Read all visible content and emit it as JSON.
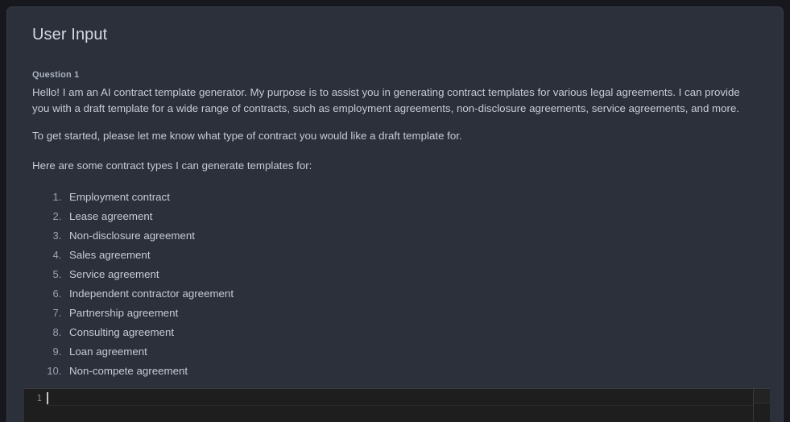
{
  "window": {
    "background_color": "#16181d",
    "panel_color": "#2b303b"
  },
  "panel": {
    "title": "User Input",
    "question_label": "Question 1",
    "paragraphs": [
      "Hello! I am an AI contract template generator. My purpose is to assist you in generating contract templates for various legal agreements. I can provide you with a draft template for a wide range of contracts, such as employment agreements, non-disclosure agreements, service agreements, and more.",
      "To get started, please let me know what type of contract you would like a draft template for.",
      "Here are some contract types I can generate templates for:"
    ],
    "list_items": [
      "Employment contract",
      "Lease agreement",
      "Non-disclosure agreement",
      "Sales agreement",
      "Service agreement",
      "Independent contractor agreement",
      "Partnership agreement",
      "Consulting agreement",
      "Loan agreement",
      "Non-compete agreement"
    ]
  },
  "editor": {
    "line_number": "1",
    "line_text": "",
    "placeholder": "",
    "background_color": "#1e1e1e",
    "caret_color": "#c8c8c8"
  }
}
